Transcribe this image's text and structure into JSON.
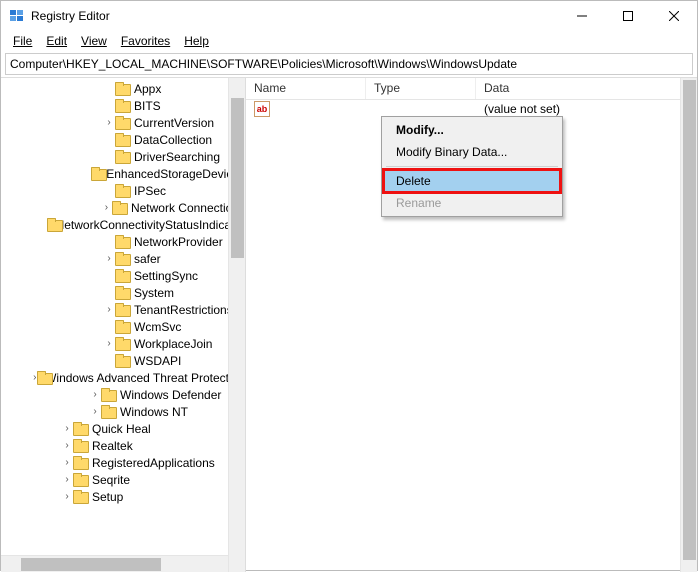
{
  "window": {
    "title": "Registry Editor"
  },
  "menu": {
    "file": "File",
    "edit": "Edit",
    "view": "View",
    "favorites": "Favorites",
    "help": "Help"
  },
  "address": {
    "path": "Computer\\HKEY_LOCAL_MACHINE\\SOFTWARE\\Policies\\Microsoft\\Windows\\WindowsUpdate"
  },
  "tree": {
    "items": [
      {
        "depth": 7,
        "chev": "",
        "label": "Appx"
      },
      {
        "depth": 7,
        "chev": "",
        "label": "BITS"
      },
      {
        "depth": 7,
        "chev": ">",
        "label": "CurrentVersion"
      },
      {
        "depth": 7,
        "chev": "",
        "label": "DataCollection"
      },
      {
        "depth": 7,
        "chev": "",
        "label": "DriverSearching"
      },
      {
        "depth": 7,
        "chev": "",
        "label": "EnhancedStorageDevices"
      },
      {
        "depth": 7,
        "chev": "",
        "label": "IPSec"
      },
      {
        "depth": 7,
        "chev": ">",
        "label": "Network Connections"
      },
      {
        "depth": 7,
        "chev": "",
        "label": "NetworkConnectivityStatusIndicator"
      },
      {
        "depth": 7,
        "chev": "",
        "label": "NetworkProvider"
      },
      {
        "depth": 7,
        "chev": ">",
        "label": "safer"
      },
      {
        "depth": 7,
        "chev": "",
        "label": "SettingSync"
      },
      {
        "depth": 7,
        "chev": "",
        "label": "System"
      },
      {
        "depth": 7,
        "chev": ">",
        "label": "TenantRestrictions"
      },
      {
        "depth": 7,
        "chev": "",
        "label": "WcmSvc"
      },
      {
        "depth": 7,
        "chev": ">",
        "label": "WorkplaceJoin"
      },
      {
        "depth": 7,
        "chev": "",
        "label": "WSDAPI"
      },
      {
        "depth": 6,
        "chev": ">",
        "label": "Windows Advanced Threat Protection"
      },
      {
        "depth": 6,
        "chev": ">",
        "label": "Windows Defender"
      },
      {
        "depth": 6,
        "chev": ">",
        "label": "Windows NT"
      },
      {
        "depth": 4,
        "chev": ">",
        "label": "Quick Heal"
      },
      {
        "depth": 4,
        "chev": ">",
        "label": "Realtek"
      },
      {
        "depth": 4,
        "chev": ">",
        "label": "RegisteredApplications"
      },
      {
        "depth": 4,
        "chev": ">",
        "label": "Seqrite"
      },
      {
        "depth": 4,
        "chev": ">",
        "label": "Setup"
      }
    ]
  },
  "list": {
    "headers": {
      "name": "Name",
      "type": "Type",
      "data": "Data"
    },
    "rows": [
      {
        "icon": "ab",
        "name": "",
        "type": "",
        "data": "(value not set)"
      }
    ]
  },
  "context": {
    "modify": "Modify...",
    "modify_binary": "Modify Binary Data...",
    "delete": "Delete",
    "rename": "Rename"
  }
}
